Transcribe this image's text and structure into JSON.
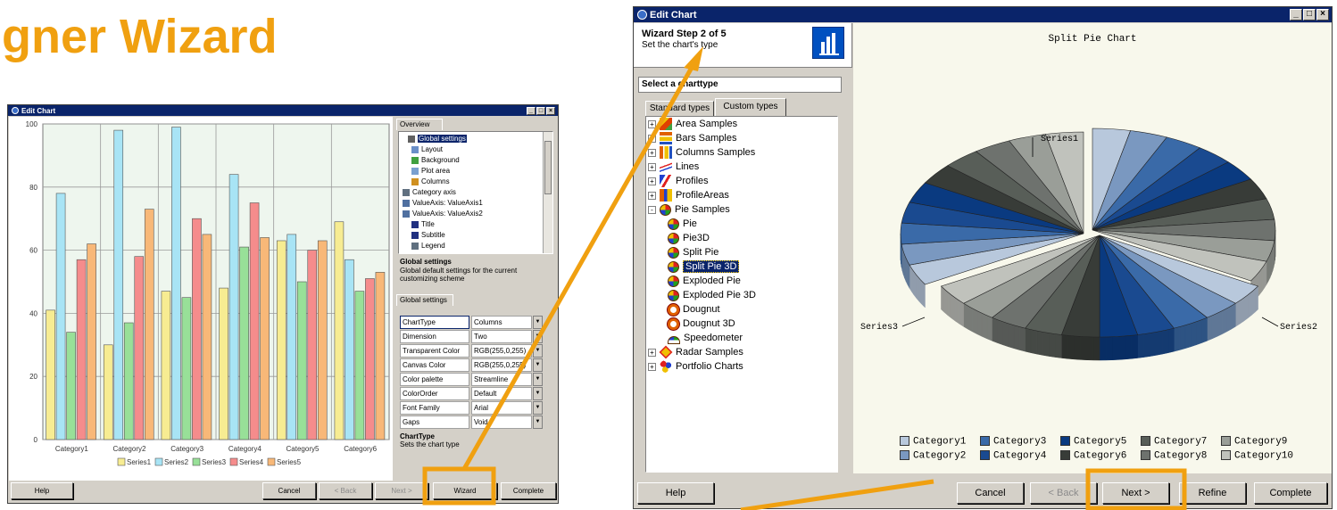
{
  "slide": {
    "title": "gner Wizard"
  },
  "small_window": {
    "title": "Edit Chart",
    "chart_data": {
      "type": "bar",
      "title": "",
      "categories": [
        "Category1",
        "Category2",
        "Category3",
        "Category4",
        "Category5",
        "Category6"
      ],
      "series": [
        {
          "name": "Series1",
          "values": [
            41,
            30,
            47,
            48,
            63,
            69
          ]
        },
        {
          "name": "Series2",
          "values": [
            78,
            98,
            99,
            84,
            65,
            57
          ]
        },
        {
          "name": "Series3",
          "values": [
            34,
            37,
            45,
            61,
            50,
            47
          ]
        },
        {
          "name": "Series4",
          "values": [
            57,
            58,
            70,
            75,
            60,
            51
          ]
        },
        {
          "name": "Series5",
          "values": [
            62,
            73,
            65,
            64,
            63,
            53
          ]
        }
      ],
      "colors": [
        "#f7ec92",
        "#a8e4f5",
        "#98e098",
        "#f58c8c",
        "#f8b878"
      ],
      "ylim": [
        0,
        100
      ],
      "yticks": [
        "0",
        "20",
        "40",
        "60",
        "80",
        "100"
      ],
      "grid": true,
      "legend": "bottom"
    },
    "overview": {
      "tab": "Overview",
      "items": [
        "Global settings",
        "Layout",
        "Background",
        "Plot area",
        "Columns",
        "Category axis",
        "ValueAxis: ValueAxis1",
        "ValueAxis: ValueAxis2",
        "Title",
        "Subtitle",
        "Legend"
      ],
      "desc_title": "Global settings",
      "desc_text": "Global default settings for the current customizing scheme"
    },
    "settings": {
      "tab": "Global settings",
      "rows": [
        {
          "key": "ChartType",
          "value": "Columns"
        },
        {
          "key": "Dimension",
          "value": "Two"
        },
        {
          "key": "Transparent Color",
          "value": "RGB(255,0,255)"
        },
        {
          "key": "Canvas Color",
          "value": "RGB(255,0,255)"
        },
        {
          "key": "Color palette",
          "value": "Streamline"
        },
        {
          "key": "ColorOrder",
          "value": "Default"
        },
        {
          "key": "Font Family",
          "value": "Arial"
        },
        {
          "key": "Gaps",
          "value": "Void"
        }
      ],
      "desc_title": "ChartType",
      "desc_text": "Sets the chart type"
    },
    "buttons": {
      "help": "Help",
      "cancel": "Cancel",
      "back": "< Back",
      "next": "Next >",
      "wizard": "Wizard",
      "complete": "Complete"
    }
  },
  "big_window": {
    "title": "Edit Chart",
    "step_title": "Wizard Step 2 of 5",
    "step_subtitle": "Set the chart's type",
    "select_label": "Select a charttype",
    "tabs": [
      "Standard types",
      "Custom types"
    ],
    "tree": [
      {
        "label": "Area Samples",
        "icon": "area-chart-icon",
        "level": 0,
        "expander": "+"
      },
      {
        "label": "Bars Samples",
        "icon": "bar-chart-icon",
        "level": 0,
        "expander": "+"
      },
      {
        "label": "Columns Samples",
        "icon": "column-chart-icon",
        "level": 0,
        "expander": "+"
      },
      {
        "label": "Lines",
        "icon": "line-chart-icon",
        "level": 0,
        "expander": "+"
      },
      {
        "label": "Profiles",
        "icon": "profile-chart-icon",
        "level": 0,
        "expander": "+"
      },
      {
        "label": "ProfileAreas",
        "icon": "profile-area-icon",
        "level": 0,
        "expander": "+"
      },
      {
        "label": "Pie Samples",
        "icon": "pie-chart-icon",
        "level": 0,
        "expander": "-"
      },
      {
        "label": "Pie",
        "icon": "pie-chart-icon",
        "level": 1
      },
      {
        "label": "Pie3D",
        "icon": "pie-chart-icon",
        "level": 1
      },
      {
        "label": "Split Pie",
        "icon": "pie-chart-icon",
        "level": 1
      },
      {
        "label": "Split Pie 3D",
        "icon": "pie-chart-icon",
        "level": 1,
        "selected": true
      },
      {
        "label": "Exploded Pie",
        "icon": "pie-chart-icon",
        "level": 1
      },
      {
        "label": "Exploded Pie 3D",
        "icon": "pie-chart-icon",
        "level": 1
      },
      {
        "label": "Dougnut",
        "icon": "doughnut-chart-icon",
        "level": 1
      },
      {
        "label": "Dougnut 3D",
        "icon": "doughnut-chart-icon",
        "level": 1
      },
      {
        "label": "Speedometer",
        "icon": "speedometer-icon",
        "level": 1
      },
      {
        "label": "Radar Samples",
        "icon": "radar-chart-icon",
        "level": 0,
        "expander": "+"
      },
      {
        "label": "Portfolio Charts",
        "icon": "portfolio-chart-icon",
        "level": 0,
        "expander": "+"
      }
    ],
    "preview": {
      "chart_title": "Split Pie Chart",
      "series_labels": [
        "Series1",
        "Series2",
        "Series3"
      ],
      "legend": [
        "Category1",
        "Category3",
        "Category5",
        "Category7",
        "Category9",
        "Category2",
        "Category4",
        "Category6",
        "Category8",
        "Category10"
      ],
      "legend_colors": [
        "#b8c8dc",
        "#3a6aa8",
        "#0a3a80",
        "#585e58",
        "#9a9e98",
        "#7a98c0",
        "#1a4a90",
        "#383c38",
        "#6e726e",
        "#c0c2bc"
      ]
    },
    "buttons": {
      "help": "Help",
      "cancel": "Cancel",
      "back": "< Back",
      "next": "Next >",
      "refine": "Refine",
      "complete": "Complete"
    }
  },
  "accent_color": "#f0a010"
}
